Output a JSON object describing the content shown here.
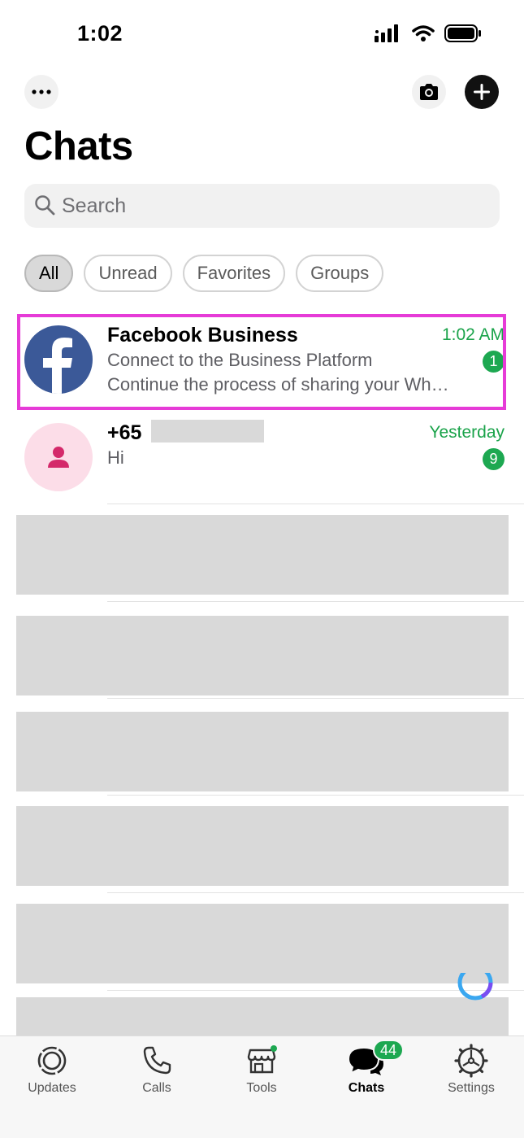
{
  "status_bar": {
    "time": "1:02"
  },
  "header": {
    "title": "Chats"
  },
  "search": {
    "placeholder": "Search"
  },
  "filters": [
    {
      "label": "All",
      "active": true
    },
    {
      "label": "Unread",
      "active": false
    },
    {
      "label": "Favorites",
      "active": false
    },
    {
      "label": "Groups",
      "active": false
    }
  ],
  "chats": [
    {
      "name": "Facebook Business",
      "time": "1:02 AM",
      "line1": "Connect to the Business Platform",
      "line2": "Continue the process of sharing your Wh…",
      "unread": "1",
      "avatar": "facebook-logo"
    },
    {
      "name": "+65",
      "time": "Yesterday",
      "line1": "Hi",
      "unread": "9",
      "avatar": "person-icon"
    }
  ],
  "tabs": [
    {
      "label": "Updates",
      "icon": "updates-icon"
    },
    {
      "label": "Calls",
      "icon": "phone-icon"
    },
    {
      "label": "Tools",
      "icon": "store-icon"
    },
    {
      "label": "Chats",
      "icon": "chats-icon",
      "badge": "44",
      "active": true
    },
    {
      "label": "Settings",
      "icon": "gear-icon"
    }
  ],
  "colors": {
    "accent": "#1da851",
    "highlight": "#e63bd7",
    "facebook": "#3b5998"
  }
}
